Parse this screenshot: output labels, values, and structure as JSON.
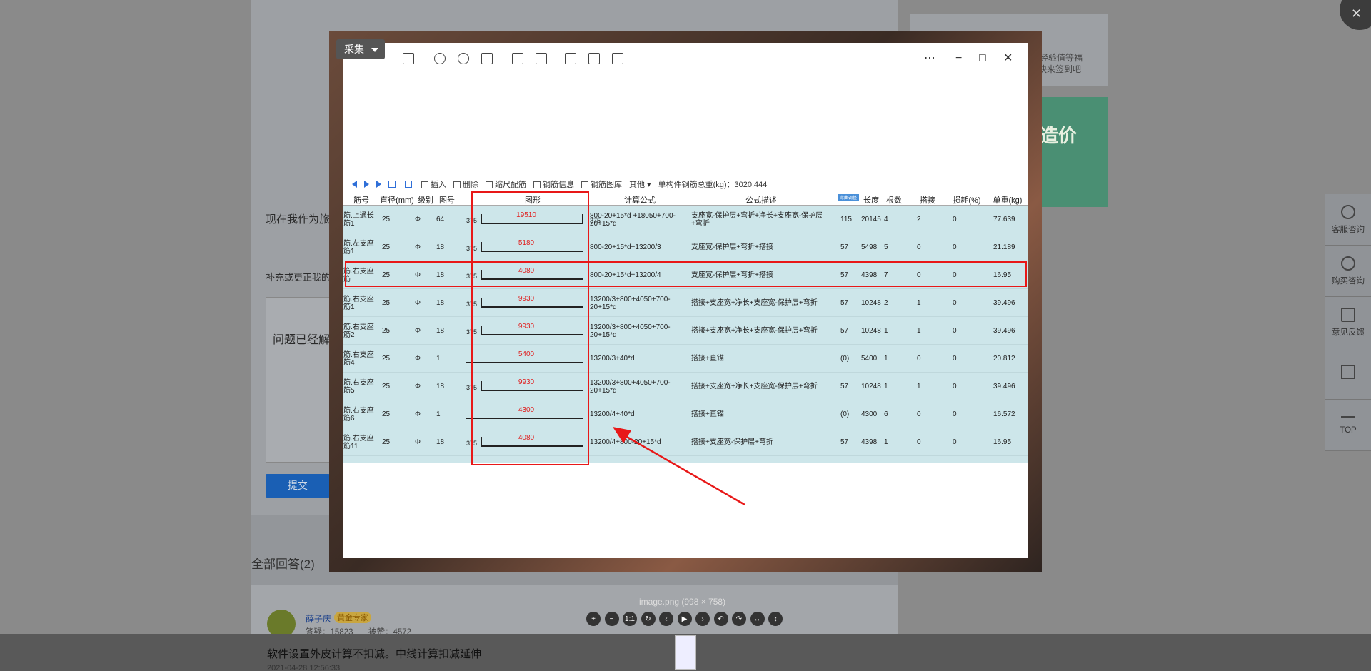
{
  "background": {
    "question_prefix": "现在我作为旅",
    "supplement_prefix": "补充或更正我的",
    "reply_prefix": "问题已经解",
    "submit_label": "提交",
    "all_answers": "全部回答(2)",
    "answer_author": "薛子庆",
    "answer_badge": "黄金专家",
    "answer_stats_answers": "答疑：15823",
    "answer_stats_likes": "被赞：4572",
    "answer_text": "软件设置外皮计算不扣减。中线计算扣减延伸",
    "answer_time": "2021-04-28 12:56:33",
    "right_card_text1": "，经验值等福",
    "right_card_text2": "快来签到吧",
    "right_promo": "造价",
    "side_tools": [
      {
        "label": "客服咨询",
        "icon": "headset-icon"
      },
      {
        "label": "购买咨询",
        "icon": "chat-icon"
      },
      {
        "label": "意见反馈",
        "icon": "edit-icon"
      },
      {
        "label": "",
        "icon": "qrcode-icon"
      },
      {
        "label": "TOP",
        "icon": "back-to-top-icon"
      }
    ]
  },
  "viewer": {
    "collect_label": "采集",
    "image_label": "image.png (998 × 758)",
    "zoom_controls": [
      "+",
      "−",
      "1:1",
      "↻",
      "‹",
      "▶",
      "›",
      "↶",
      "↷",
      "↔",
      "↕"
    ]
  },
  "sheet": {
    "toolbar": {
      "insert": "插入",
      "delete": "删除",
      "scale_rebar": "缩尺配筋",
      "rebar_info": "钢筋信息",
      "rebar_lib": "钢筋图库",
      "other": "其他",
      "total_weight_label": "单构件钢筋总重(kg)：3020.444"
    },
    "columns": [
      "筋号",
      "直径(mm)",
      "级别",
      "图号",
      "图形",
      "计算公式",
      "公式描述",
      "弯曲调整",
      "长度",
      "根数",
      "搭接",
      "损耗(%)",
      "单重(kg)"
    ],
    "rows": [
      {
        "name": "筋.上通长筋1",
        "dia": "25",
        "grade": "Φ",
        "fig": "64",
        "shape_len": "19510",
        "left": "375",
        "right": "375",
        "formula": "800-20+15*d +18050+700-20+15*d",
        "desc": "支座宽-保护层+弯折+净长+支座宽-保护层+弯折",
        "adj": "115",
        "length": "20145",
        "count": "4",
        "lap": "2",
        "loss": "0",
        "weight": "77.639"
      },
      {
        "name": "筋.左支座筋1",
        "dia": "25",
        "grade": "Φ",
        "fig": "18",
        "shape_len": "5180",
        "left": "375",
        "right": "",
        "formula": "800-20+15*d+13200/3",
        "desc": "支座宽-保护层+弯折+搭接",
        "adj": "57",
        "length": "5498",
        "count": "5",
        "lap": "0",
        "loss": "0",
        "weight": "21.189"
      },
      {
        "name": "筋.右支座筋",
        "dia": "25",
        "grade": "Φ",
        "fig": "18",
        "shape_len": "4080",
        "left": "375",
        "right": "",
        "formula": "800-20+15*d+13200/4",
        "desc": "支座宽-保护层+弯折+搭接",
        "adj": "57",
        "length": "4398",
        "count": "7",
        "lap": "0",
        "loss": "0",
        "weight": "16.95"
      },
      {
        "name": "筋.右支座筋1",
        "dia": "25",
        "grade": "Φ",
        "fig": "18",
        "shape_len": "9930",
        "left": "375",
        "right": "",
        "formula": "13200/3+800+4050+700-20+15*d",
        "desc": "搭接+支座宽+净长+支座宽-保护层+弯折",
        "adj": "57",
        "length": "10248",
        "count": "2",
        "lap": "1",
        "loss": "0",
        "weight": "39.496"
      },
      {
        "name": "筋.右支座筋2",
        "dia": "25",
        "grade": "Φ",
        "fig": "18",
        "shape_len": "9930",
        "left": "375",
        "right": "",
        "formula": "13200/3+800+4050+700-20+15*d",
        "desc": "搭接+支座宽+净长+支座宽-保护层+弯折",
        "adj": "57",
        "length": "10248",
        "count": "1",
        "lap": "1",
        "loss": "0",
        "weight": "39.496"
      },
      {
        "name": "筋.右支座筋4",
        "dia": "25",
        "grade": "Φ",
        "fig": "1",
        "shape_len": "5400",
        "left": "",
        "right": "",
        "formula": "13200/3+40*d",
        "desc": "搭接+直锚",
        "adj": "(0)",
        "length": "5400",
        "count": "1",
        "lap": "0",
        "loss": "0",
        "weight": "20.812"
      },
      {
        "name": "筋.右支座筋5",
        "dia": "25",
        "grade": "Φ",
        "fig": "18",
        "shape_len": "9930",
        "left": "375",
        "right": "",
        "formula": "13200/3+800+4050+700-20+15*d",
        "desc": "搭接+支座宽+净长+支座宽-保护层+弯折",
        "adj": "57",
        "length": "10248",
        "count": "1",
        "lap": "1",
        "loss": "0",
        "weight": "39.496"
      },
      {
        "name": "筋.右支座筋6",
        "dia": "25",
        "grade": "Φ",
        "fig": "1",
        "shape_len": "4300",
        "left": "",
        "right": "",
        "formula": "13200/4+40*d",
        "desc": "搭接+直锚",
        "adj": "(0)",
        "length": "4300",
        "count": "6",
        "lap": "0",
        "loss": "0",
        "weight": "16.572"
      },
      {
        "name": "筋.右支座筋11",
        "dia": "25",
        "grade": "Φ",
        "fig": "18",
        "shape_len": "4080",
        "left": "375",
        "right": "",
        "formula": "13200/4+800-20+15*d",
        "desc": "搭接+支座宽-保护层+弯折",
        "adj": "57",
        "length": "4398",
        "count": "1",
        "lap": "0",
        "loss": "0",
        "weight": "16.95"
      }
    ]
  },
  "colors": {
    "highlight": "#e81818",
    "row_bg": "#cde6ea",
    "accent": "#2f6fd8"
  }
}
